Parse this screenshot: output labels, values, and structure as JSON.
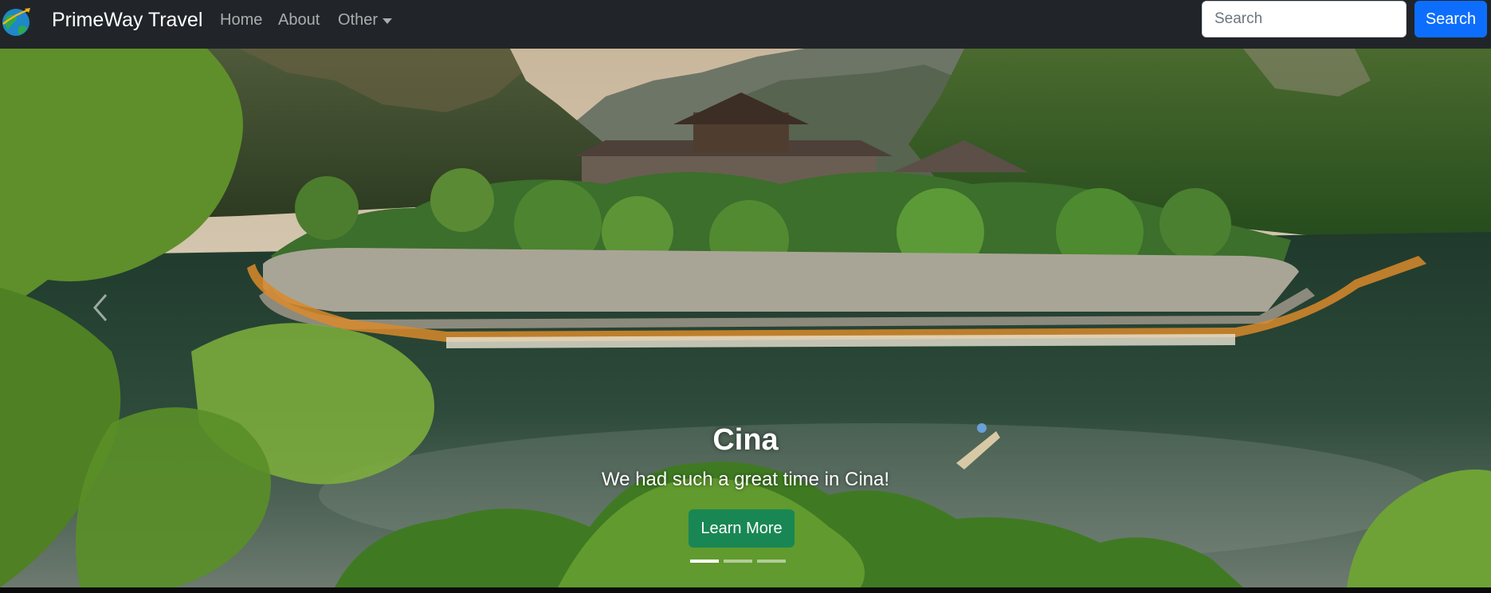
{
  "navbar": {
    "brand": "PrimeWay Travel",
    "links": [
      {
        "label": "Home"
      },
      {
        "label": "About"
      },
      {
        "label": "Other"
      }
    ],
    "search": {
      "placeholder": "Search",
      "button_label": "Search"
    }
  },
  "carousel": {
    "slides_count": 3,
    "active_index": 0,
    "caption": {
      "title": "Cina",
      "text": "We had such a great time in Cina!",
      "button_label": "Learn More"
    }
  },
  "colors": {
    "navbar_bg": "#212529",
    "primary": "#0d6efd",
    "success": "#198754"
  },
  "icons": {
    "brand": "globe-plane-icon",
    "prev": "chevron-left-icon",
    "dropdown": "caret-down-icon"
  }
}
